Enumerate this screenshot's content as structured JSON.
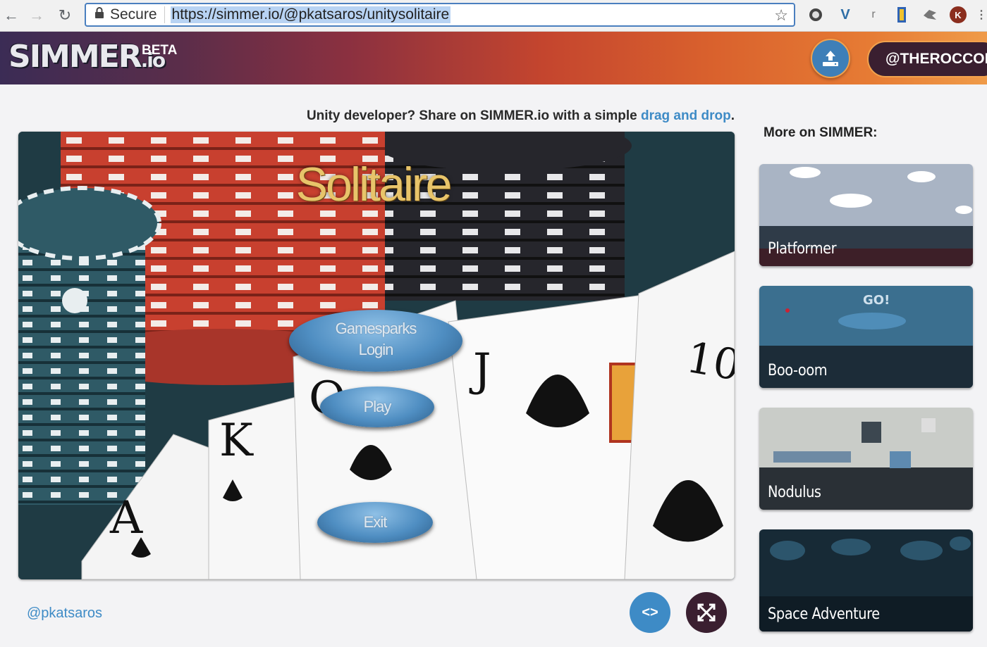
{
  "browser": {
    "secure_label": "Secure",
    "url": "https://simmer.io/@pkatsaros/unitysolitaire",
    "extensions": [
      "shield-ext-icon",
      "vue-ext-icon",
      "r-ext-icon",
      "ruler-ext-icon",
      "bird-ext-icon",
      "k-ext-icon"
    ],
    "ext_r_label": "r",
    "ext_k_label": "K"
  },
  "header": {
    "logo_main": "SIMMER",
    "logo_suffix": ".io",
    "beta_label": "BETA",
    "user_handle": "@THEROCCOB"
  },
  "share": {
    "prefix": "Unity developer? Share on ",
    "brand": "SIMMER.io",
    "middle": " with a simple ",
    "link": "drag and drop",
    "suffix": "."
  },
  "game": {
    "title": "Solitaire",
    "buttons": {
      "login_line1": "Gamesparks",
      "login_line2": "Login",
      "play": "Play",
      "exit": "Exit"
    },
    "card_labels": {
      "ace": "A",
      "king": "K",
      "queen": "Q",
      "jack": "J",
      "ten": "10"
    },
    "colors": {
      "chip_red": "#c8402f",
      "chip_dark": "#2a2a30",
      "chip_teal": "#2f5a66",
      "felt": "#1f3b44"
    }
  },
  "author": "@pkatsaros",
  "controls": {
    "embed_label": "<>"
  },
  "sidebar": {
    "title": "More on SIMMER:",
    "items": [
      {
        "label": "Platformer"
      },
      {
        "label": "Boo-oom",
        "overlay": "GO!"
      },
      {
        "label": "Nodulus"
      },
      {
        "label": "Space Adventure"
      }
    ]
  }
}
